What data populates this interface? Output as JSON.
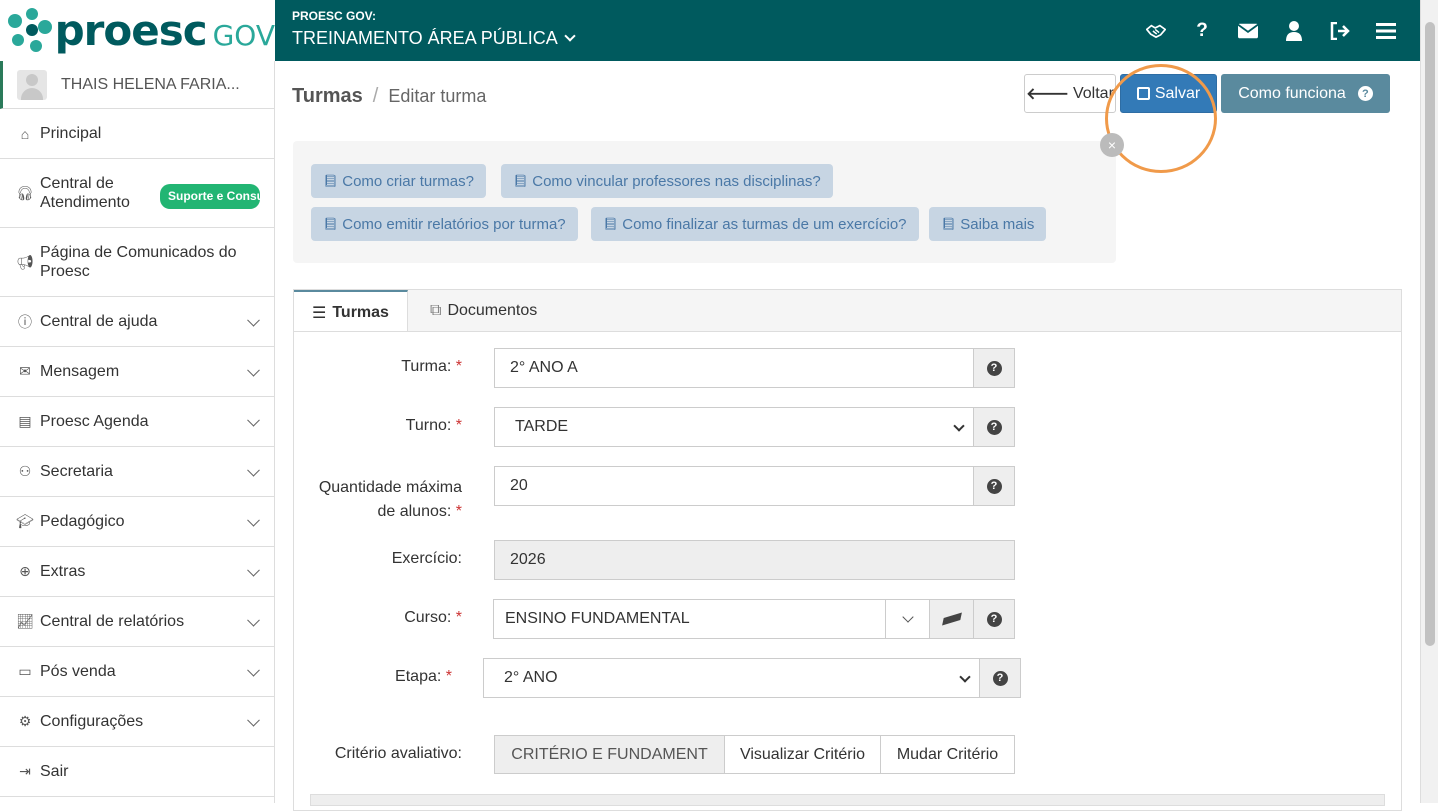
{
  "brand": {
    "word": "proesc",
    "suffix": "GOV"
  },
  "org": {
    "label": "PROESC GOV:",
    "name": "TREINAMENTO ÁREA PÚBLICA"
  },
  "top_icons": [
    "handshake-icon",
    "question-icon",
    "envelope-icon",
    "user-icon",
    "sign-out-icon",
    "menu-icon"
  ],
  "user": {
    "name": "THAIS HELENA FARIA..."
  },
  "menu": [
    {
      "label": "Principal",
      "icon": "home-icon"
    },
    {
      "label": "Central de Atendimento",
      "icon": "headset-icon",
      "badge": "Suporte e Consultoria"
    },
    {
      "label": "Página de Comunicados do Proesc",
      "icon": "megaphone-icon"
    },
    {
      "label": "Central de ajuda",
      "icon": "info-icon"
    },
    {
      "label": "Mensagem",
      "icon": "envelope-icon"
    },
    {
      "label": "Proesc Agenda",
      "icon": "agenda-icon"
    },
    {
      "label": "Secretaria",
      "icon": "users-icon"
    },
    {
      "label": "Pedagógico",
      "icon": "graduation-icon"
    },
    {
      "label": "Extras",
      "icon": "plus-circle-icon"
    },
    {
      "label": "Central de relatórios",
      "icon": "chart-icon"
    },
    {
      "label": "Pós venda",
      "icon": "ticket-icon"
    },
    {
      "label": "Configurações",
      "icon": "gear-icon"
    },
    {
      "label": "Sair",
      "icon": "exit-icon"
    }
  ],
  "breadcrumb": {
    "section": "Turmas",
    "sep": "/",
    "page": "Editar turma"
  },
  "actions": {
    "back": "Voltar",
    "save": "Salvar",
    "how": "Como funciona"
  },
  "help_links": [
    "Como criar turmas?",
    "Como vincular professores nas disciplinas?",
    "Como emitir relatórios por turma?",
    "Como finalizar as turmas de um exercício?",
    "Saiba mais"
  ],
  "tabs": [
    "Turmas",
    "Documentos"
  ],
  "form": {
    "turma": {
      "label": "Turma:",
      "value": "2° ANO A"
    },
    "turno": {
      "label": "Turno:",
      "value": "TARDE"
    },
    "qtd": {
      "label1": "Quantidade máxima",
      "label2": "de alunos:",
      "value": "20"
    },
    "exercicio": {
      "label": "Exercício:",
      "value": "2026"
    },
    "curso": {
      "label": "Curso:",
      "value": "ENSINO FUNDAMENTAL"
    },
    "etapa": {
      "label": "Etapa:",
      "value": "2° ANO"
    },
    "criterio": {
      "label": "Critério avaliativo:",
      "value": "CRITÉRIO E FUNDAMENT",
      "view": "Visualizar Critério",
      "change": "Mudar Critério"
    }
  },
  "colors": {
    "header": "#005a5e",
    "accent": "#2aa89a",
    "primary": "#337ab7",
    "highlight_ring": "#f09a4a"
  }
}
